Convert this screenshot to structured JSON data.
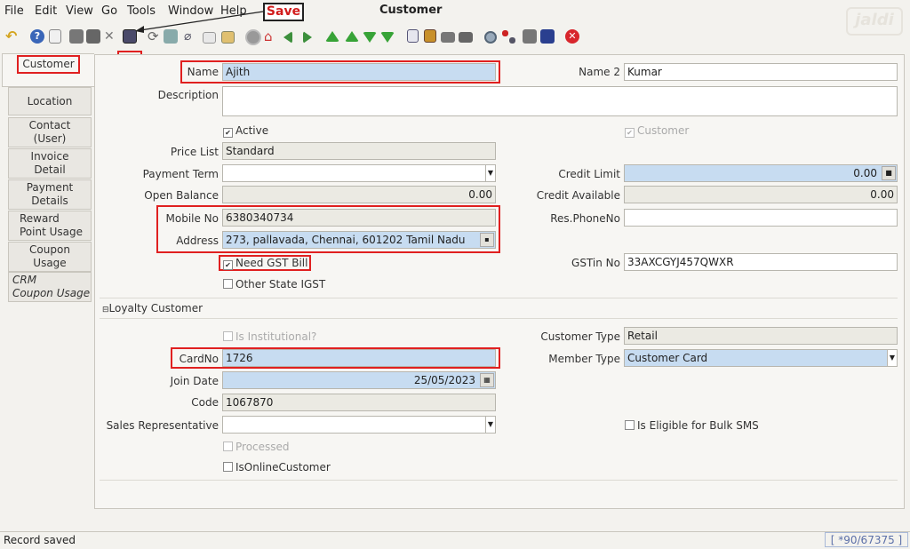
{
  "menu": {
    "items": [
      "File",
      "Edit",
      "View",
      "Go",
      "Tools",
      "Window",
      "Help"
    ],
    "window_title": "Customer",
    "logo_text": "jaldi"
  },
  "toolbar": {
    "save_callout": "Save",
    "icons": [
      "undo-icon",
      "help-icon",
      "new-icon",
      "copy-icon",
      "delete-icon",
      "delete-selection-icon",
      "save-icon",
      "refresh-icon",
      "find-icon",
      "attachment-icon",
      "chat-icon",
      "history-icon",
      "lock-icon",
      "home-icon",
      "previous-icon",
      "next-icon",
      "first-record-icon",
      "previous-record-icon",
      "next-record-icon",
      "last-record-icon",
      "report-icon",
      "archive-icon",
      "print-preview-icon",
      "print-icon",
      "zoom-across-icon",
      "workflow-icon",
      "product-info-icon",
      "account-info-icon",
      "close-icon"
    ]
  },
  "tabs": [
    {
      "label": "Customer",
      "active": true
    },
    {
      "label": "Location"
    },
    {
      "label": "Contact\n(User)"
    },
    {
      "label": "Invoice\nDetail"
    },
    {
      "label": "Payment\nDetails"
    },
    {
      "label": "Reward\nPoint Usage"
    },
    {
      "label": "Coupon\nUsage"
    },
    {
      "label": "CRM\nCoupon Usage"
    }
  ],
  "tab_labels": {
    "customer": "Customer",
    "location": "Location",
    "contact_1": "Contact",
    "contact_2": "(User)",
    "invoice_1": "Invoice",
    "invoice_2": "Detail",
    "payment_1": "Payment",
    "payment_2": "Details",
    "reward_1": "Reward",
    "reward_2": "Point Usage",
    "coupon_1": "Coupon",
    "coupon_2": "Usage",
    "crm_1": "CRM",
    "crm_2": "Coupon Usage"
  },
  "form": {
    "name_label": "Name",
    "name_value": "Ajith",
    "name2_label": "Name 2",
    "name2_value": "Kumar",
    "description_label": "Description",
    "description_value": "",
    "active_label": "Active",
    "active_checked": true,
    "customer_label": "Customer",
    "customer_checked": true,
    "pricelist_label": "Price List",
    "pricelist_value": "Standard",
    "paymentterm_label": "Payment Term",
    "paymentterm_value": "",
    "creditlimit_label": "Credit Limit",
    "creditlimit_value": "0.00",
    "openbalance_label": "Open Balance",
    "openbalance_value": "0.00",
    "creditavailable_label": "Credit Available",
    "creditavailable_value": "0.00",
    "mobile_label": "Mobile No",
    "mobile_value": "6380340734",
    "resphone_label": "Res.PhoneNo",
    "resphone_value": "",
    "address_label": "Address",
    "address_value": "273, pallavada, Chennai,  601202 Tamil Nadu",
    "needgst_label": "Need GST Bill",
    "needgst_checked": true,
    "gstin_label": "GSTin No",
    "gstin_value": "33AXCGYJ457QWXR",
    "otherstate_label": "Other State IGST",
    "otherstate_checked": false
  },
  "loyalty": {
    "section_label": "Loyalty Customer",
    "institutional_label": "Is Institutional?",
    "customertype_label": "Customer Type",
    "customertype_value": "Retail",
    "cardno_label": "CardNo",
    "cardno_value": "1726",
    "membertype_label": "Member Type",
    "membertype_value": "Customer Card",
    "joindate_label": "Join Date",
    "joindate_value": "25/05/2023",
    "code_label": "Code",
    "code_value": "1067870",
    "salesrep_label": "Sales Representative",
    "salesrep_value": "",
    "bulksms_label": "Is Eligible for Bulk SMS",
    "processed_label": "Processed",
    "isonline_label": "IsOnlineCustomer"
  },
  "status": {
    "message": "Record saved",
    "record_count": "[ *90/67375 ]"
  },
  "colors": {
    "mandatory_field": "#c7dcf1",
    "readonly_field": "#ebeae3",
    "annotation": "#e02020"
  }
}
